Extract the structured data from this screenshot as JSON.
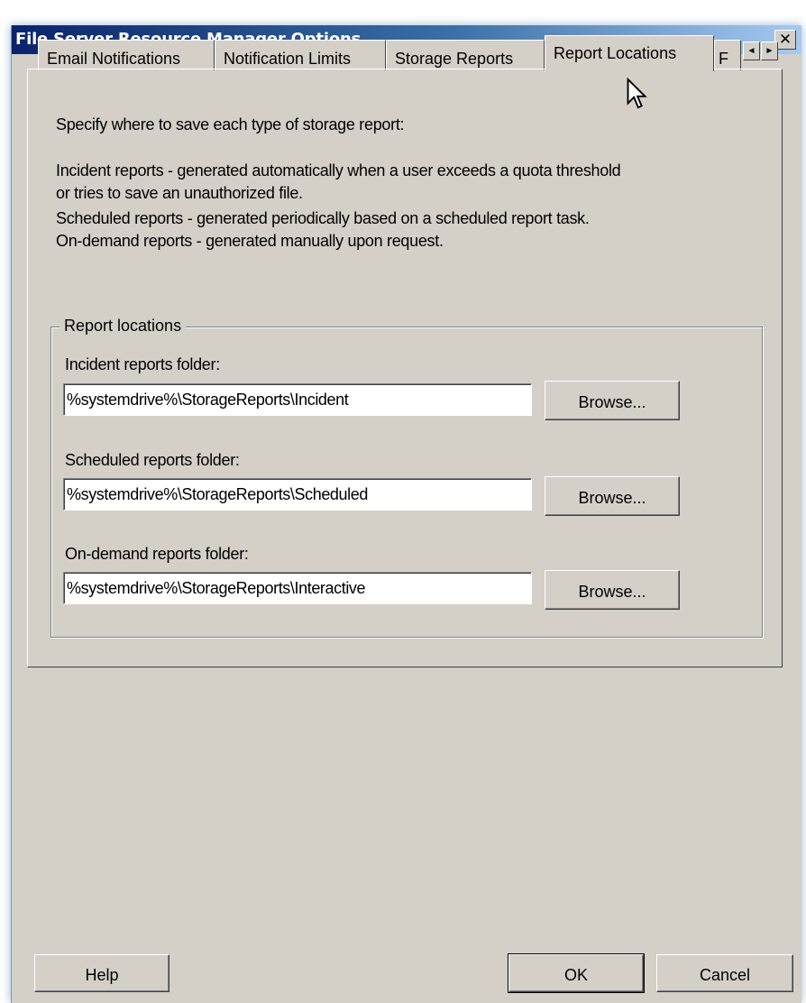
{
  "window": {
    "title": "File Server Resource Manager Options",
    "close_glyph": "✕"
  },
  "tabs": [
    {
      "label": "Email Notifications",
      "active": false
    },
    {
      "label": "Notification Limits",
      "active": false
    },
    {
      "label": "Storage Reports",
      "active": false
    },
    {
      "label": "Report Locations",
      "active": true
    },
    {
      "label": "F",
      "active": false
    }
  ],
  "tab_scroll": {
    "left_glyph": "◄",
    "right_glyph": "►"
  },
  "intro": {
    "heading": "Specify where to save each type of storage report:",
    "lines": [
      "Incident reports - generated automatically when a user exceeds a quota threshold",
      "or tries to save an unauthorized file.",
      "Scheduled reports - generated periodically based on a scheduled report task.",
      "On-demand reports - generated manually upon request."
    ]
  },
  "group": {
    "legend": "Report locations",
    "folders": [
      {
        "label": "Incident reports folder:",
        "value": "%systemdrive%\\StorageReports\\Incident",
        "browse": "Browse..."
      },
      {
        "label": "Scheduled reports folder:",
        "value": "%systemdrive%\\StorageReports\\Scheduled",
        "browse": "Browse..."
      },
      {
        "label": "On-demand reports folder:",
        "value": "%systemdrive%\\StorageReports\\Interactive",
        "browse": "Browse..."
      }
    ]
  },
  "footer": {
    "help": "Help",
    "ok": "OK",
    "cancel": "Cancel"
  },
  "colors": {
    "face": "#d4d0c8",
    "title_start": "#0a246a",
    "title_end": "#a6caf0"
  }
}
